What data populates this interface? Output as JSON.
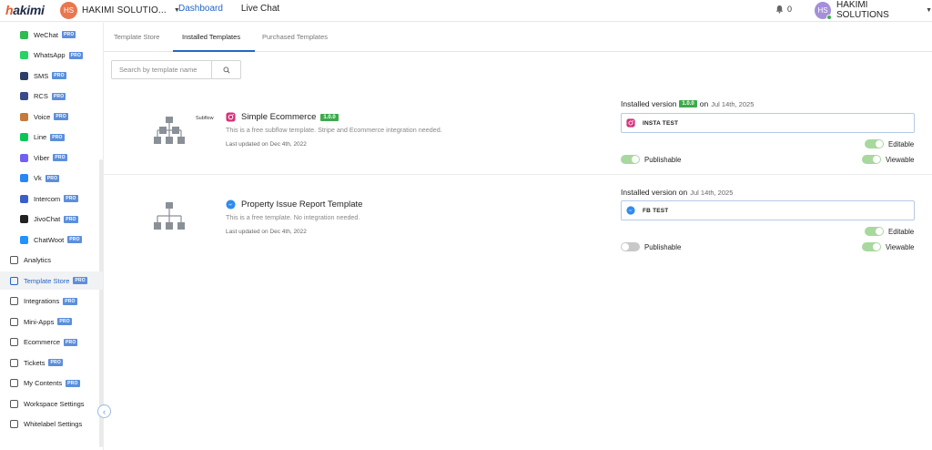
{
  "brand": {
    "logo": "hakimi"
  },
  "workspace": {
    "initials": "HS",
    "name": "HAKIMI SOLUTIO..."
  },
  "topnav": {
    "dashboard": "Dashboard",
    "live_chat": "Live Chat"
  },
  "notifications": {
    "count": "0"
  },
  "user": {
    "initials": "HS",
    "name": "HAKIMI SOLUTIONS"
  },
  "sidebar": {
    "pro_label": "PRO",
    "channels": [
      {
        "label": "WeChat",
        "icon": "wechat-icon",
        "color": "#2fbb4f"
      },
      {
        "label": "WhatsApp",
        "icon": "whatsapp-icon",
        "color": "#25d366"
      },
      {
        "label": "SMS",
        "icon": "sms-icon",
        "color": "#2d3e67"
      },
      {
        "label": "RCS",
        "icon": "rcs-icon",
        "color": "#3a4a8a"
      },
      {
        "label": "Voice",
        "icon": "voice-icon",
        "color": "#c67a3a"
      },
      {
        "label": "Line",
        "icon": "line-icon",
        "color": "#06c755"
      },
      {
        "label": "Viber",
        "icon": "viber-icon",
        "color": "#7360f2"
      },
      {
        "label": "Vk",
        "icon": "vk-icon",
        "color": "#2787f5"
      },
      {
        "label": "Intercom",
        "icon": "intercom-icon",
        "color": "#3b5ec9"
      },
      {
        "label": "JivoChat",
        "icon": "jivochat-icon",
        "color": "#222222"
      },
      {
        "label": "ChatWoot",
        "icon": "chatwoot-icon",
        "color": "#1f93ff"
      }
    ],
    "main": [
      {
        "label": "Analytics",
        "icon": "analytics-icon",
        "pro": false
      },
      {
        "label": "Template Store",
        "icon": "template-store-icon",
        "pro": true
      },
      {
        "label": "Integrations",
        "icon": "integrations-icon",
        "pro": true
      },
      {
        "label": "Mini-Apps",
        "icon": "mini-apps-icon",
        "pro": true
      },
      {
        "label": "Ecommerce",
        "icon": "ecommerce-icon",
        "pro": true
      },
      {
        "label": "Tickets",
        "icon": "tickets-icon",
        "pro": true
      },
      {
        "label": "My Contents",
        "icon": "my-contents-icon",
        "pro": true
      },
      {
        "label": "Workspace Settings",
        "icon": "workspace-settings-icon",
        "pro": false
      },
      {
        "label": "Whitelabel Settings",
        "icon": "whitelabel-settings-icon",
        "pro": false
      }
    ]
  },
  "tabs": [
    {
      "label": "Template Store"
    },
    {
      "label": "Installed Templates"
    },
    {
      "label": "Purchased Templates"
    }
  ],
  "search": {
    "placeholder": "Search by template name"
  },
  "templates": [
    {
      "badge": "Subflow",
      "channel_icon": "instagram-icon",
      "title": "Simple Ecommerce",
      "version": "1.0.0",
      "description": "This is a free subflow template. Stripe and Ecommerce integration needed.",
      "updated": "Last updated on Dec 4th, 2022",
      "installed_prefix": "Installed version",
      "installed_on": "on",
      "installed_date": "Jul 14th, 2025",
      "bot_name": "INSTA TEST",
      "editable": {
        "label": "Editable",
        "on": true
      },
      "publishable": {
        "label": "Publishable",
        "on": true
      },
      "viewable": {
        "label": "Viewable",
        "on": true
      }
    },
    {
      "channel_icon": "messenger-icon",
      "title": "Property Issue Report Template",
      "description": "This is a free template. No integration needed.",
      "updated": "Last updated on Dec 4th, 2022",
      "installed_prefix": "Installed version on",
      "installed_date": "Jul 14th, 2025",
      "bot_name": "FB TEST",
      "editable": {
        "label": "Editable",
        "on": true
      },
      "publishable": {
        "label": "Publishable",
        "on": false
      },
      "viewable": {
        "label": "Viewable",
        "on": true
      }
    }
  ]
}
